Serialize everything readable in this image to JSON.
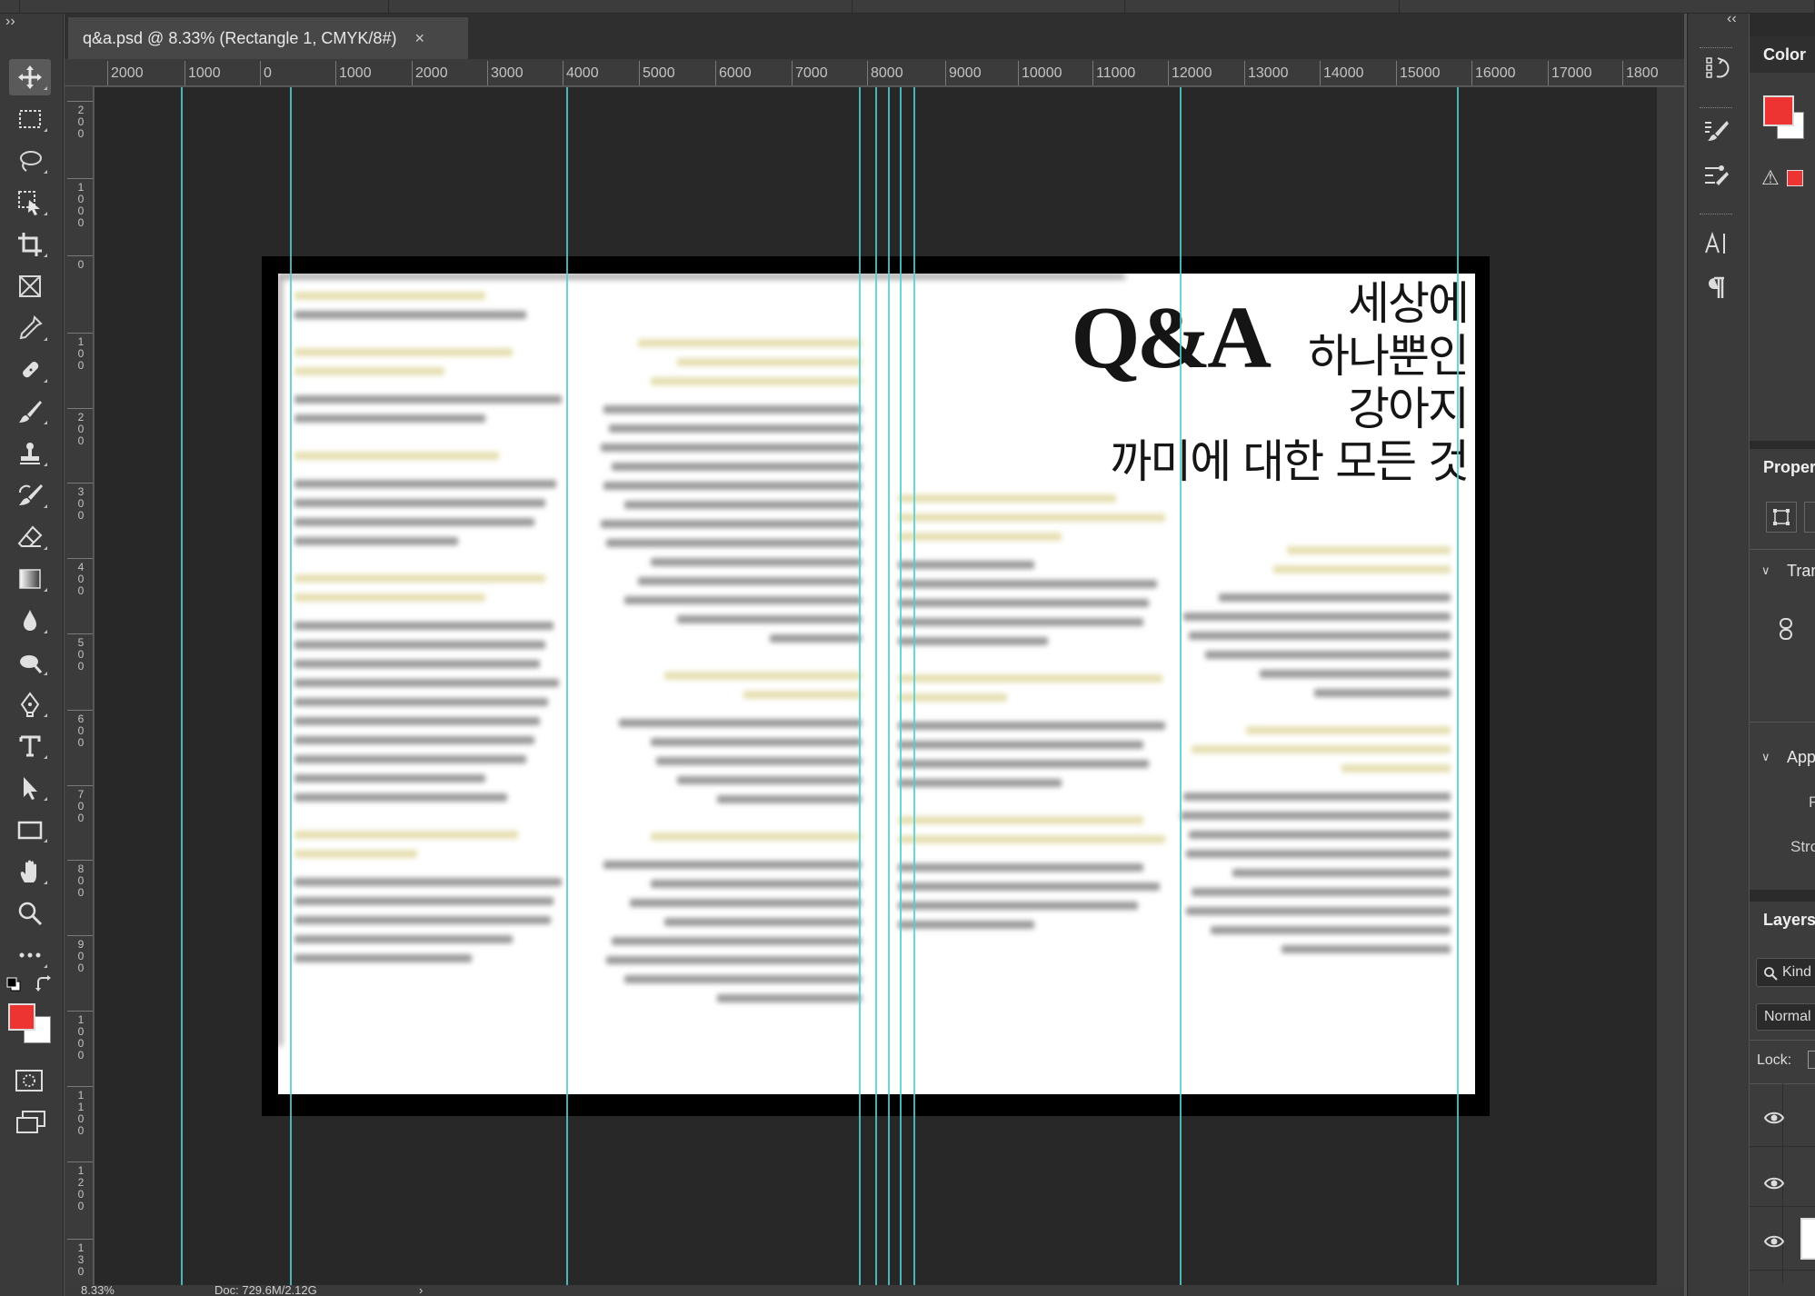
{
  "top_strip": {
    "segments": 6
  },
  "toolbar": {
    "collapse_glyph": "››",
    "tools": [
      {
        "name": "move-tool",
        "icon": "move-icon",
        "active": true
      },
      {
        "name": "marquee-tool",
        "icon": "rect-marquee-icon"
      },
      {
        "name": "lasso-tool",
        "icon": "lasso-icon"
      },
      {
        "name": "object-select-tool",
        "icon": "object-select-icon"
      },
      {
        "name": "crop-tool",
        "icon": "crop-icon"
      },
      {
        "name": "frame-tool",
        "icon": "frame-icon"
      },
      {
        "name": "eyedropper-tool",
        "icon": "eyedropper-icon"
      },
      {
        "name": "healing-brush-tool",
        "icon": "healing-brush-icon"
      },
      {
        "name": "brush-tool",
        "icon": "brush-icon"
      },
      {
        "name": "clone-stamp-tool",
        "icon": "stamp-icon"
      },
      {
        "name": "history-brush-tool",
        "icon": "history-brush-icon"
      },
      {
        "name": "eraser-tool",
        "icon": "eraser-icon"
      },
      {
        "name": "gradient-tool",
        "icon": "gradient-icon"
      },
      {
        "name": "blur-tool",
        "icon": "drop-icon"
      },
      {
        "name": "dodge-tool",
        "icon": "dodge-icon"
      },
      {
        "name": "pen-tool",
        "icon": "pen-icon"
      },
      {
        "name": "type-tool",
        "icon": "type-icon",
        "glyph": "T"
      },
      {
        "name": "path-select-tool",
        "icon": "arrow-icon"
      },
      {
        "name": "rectangle-tool",
        "icon": "rectangle-icon"
      },
      {
        "name": "hand-tool",
        "icon": "hand-icon"
      },
      {
        "name": "zoom-tool",
        "icon": "zoom-icon"
      },
      {
        "name": "more-tools",
        "icon": "more-icon",
        "glyph": "•••"
      }
    ],
    "foreground_color": "#ee3333",
    "background_color": "#ffffff"
  },
  "document": {
    "tab_title": "q&a.psd @ 8.33% (Rectangle 1, CMYK/8#)",
    "close_glyph": "×"
  },
  "ruler": {
    "top_labels": [
      "2000",
      "1000",
      "0",
      "1000",
      "2000",
      "3000",
      "4000",
      "5000",
      "6000",
      "7000",
      "8000",
      "9000",
      "10000",
      "11000",
      "12000",
      "13000",
      "14000",
      "15000",
      "16000",
      "17000",
      "1800"
    ],
    "left_labels": [
      "2\n0\n0",
      "1\n0\n0\n0",
      "0",
      "1\n0\n0",
      "2\n0\n0",
      "3\n0\n0",
      "4\n0\n0",
      "5\n0\n0",
      "6\n0\n0",
      "7\n0\n0",
      "8\n0\n0",
      "9\n0\n0",
      "1\n0\n0\n0",
      "1\n1\n0\n0",
      "1\n2\n0\n0",
      "1\n3\n0"
    ]
  },
  "canvas_content": {
    "title_main": "Q&A",
    "title_line1": "세상에",
    "title_line2": "하나뿐인",
    "title_line3": "강아지",
    "title_line4": "까미에 대한 모든 것",
    "guide_color": "#4fd0d0"
  },
  "status_bar": {
    "zoom": "8.33%",
    "doc_info": "Doc: 729.6M/2.12G",
    "arrow": "›"
  },
  "right_strip": {
    "collapse_glyph": "‹‹",
    "icons": [
      "history-icon",
      "brush-settings-icon",
      "adjustments-icon",
      "character-icon",
      "paragraph-icon"
    ]
  },
  "panels": {
    "color": {
      "title": "Color",
      "fg": "#ee3333",
      "bg": "#ffffff",
      "warning_glyph": "⚠"
    },
    "properties": {
      "title": "Proper",
      "transform": "Tran",
      "appearance": "App",
      "fill_label": "F",
      "stroke_label": "Stro"
    },
    "layers": {
      "title": "Layers",
      "kind_placeholder": "Kind",
      "blend_mode": "Normal",
      "lock_label": "Lock:"
    }
  }
}
